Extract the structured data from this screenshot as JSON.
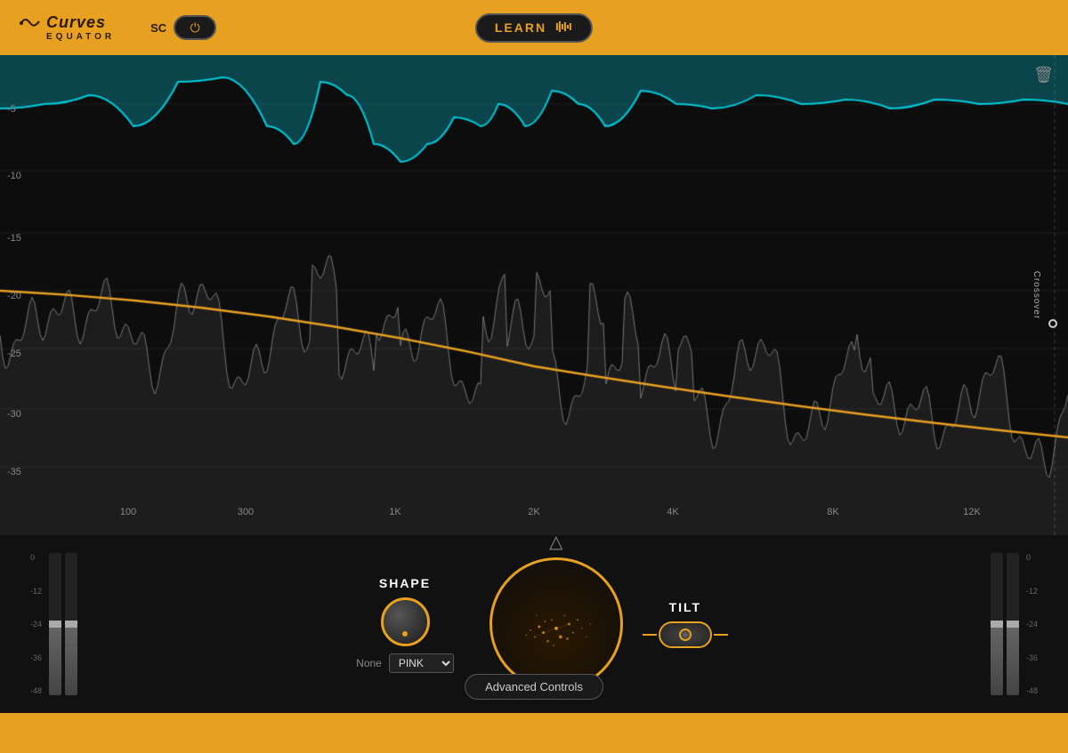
{
  "header": {
    "logo_curves": "Curves",
    "logo_equator": "EQUATOR",
    "sc_label": "SC",
    "learn_label": "LEARN"
  },
  "eq_display": {
    "y_labels": [
      "-5",
      "-10",
      "-15",
      "-20",
      "-25",
      "-30",
      "-35"
    ],
    "x_labels": [
      "100",
      "300",
      "1K",
      "2K",
      "4K",
      "8K",
      "12K"
    ],
    "crossover_label": "Crossover",
    "delete_label": "🗑"
  },
  "controls": {
    "shape_label": "SHAPE",
    "none_label": "None",
    "pink_label": "PINK",
    "tilt_label": "TILT",
    "advanced_controls_label": "Advanced Controls",
    "vu_labels_left": [
      "0",
      "-12",
      "-24",
      "-36",
      "-48"
    ],
    "vu_labels_right": [
      "0",
      "-12",
      "-24",
      "-36",
      "-48"
    ]
  }
}
